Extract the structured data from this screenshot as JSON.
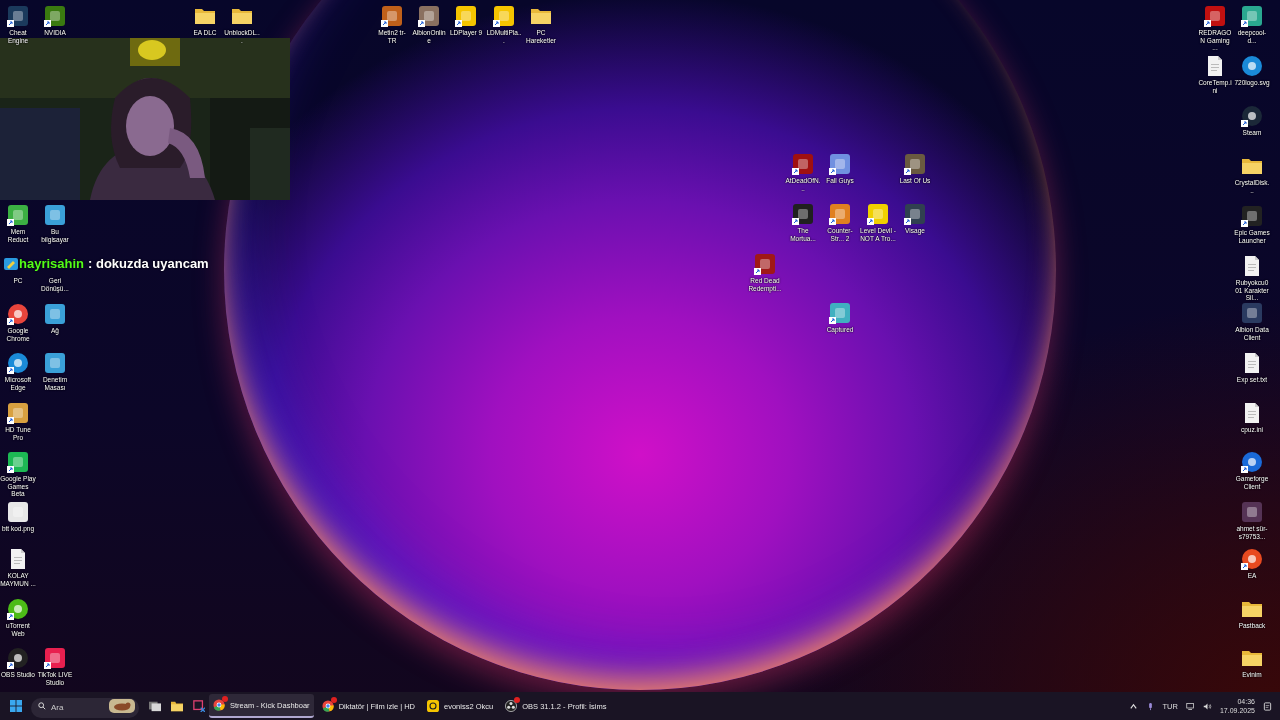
{
  "desktop": {
    "left_icons": [
      {
        "label": "Cheat Engine",
        "shortcut": true
      },
      {
        "label": "NVIDIA",
        "shortcut": true
      },
      {
        "label": "Mem Reduct",
        "shortcut": true
      },
      {
        "label": "Bu bilgisayar",
        "shortcut": false
      },
      {
        "label": "PC",
        "shortcut": false
      },
      {
        "label": "Geri Dönüşü...",
        "shortcut": false
      },
      {
        "label": "Google Chrome",
        "shortcut": true
      },
      {
        "label": "Ağ",
        "shortcut": false
      },
      {
        "label": "Microsoft Edge",
        "shortcut": true
      },
      {
        "label": "Denetim Masası",
        "shortcut": false
      },
      {
        "label": "HD Tune Pro",
        "shortcut": true
      },
      {
        "label": "Google Play Games Beta",
        "shortcut": true
      },
      {
        "label": "btt kod.png",
        "shortcut": false
      },
      {
        "label": "KOLAY MAYMUN ...",
        "shortcut": false
      },
      {
        "label": "uTorrent Web",
        "shortcut": true
      },
      {
        "label": "OBS Studio",
        "shortcut": true
      },
      {
        "label": "TikTok LIVE Studio",
        "shortcut": true
      }
    ],
    "top_icons": [
      {
        "label": "EA DLC",
        "shortcut": false
      },
      {
        "label": "UnblockDL...",
        "shortcut": false
      },
      {
        "label": "Metin2 tr-TR",
        "shortcut": true
      },
      {
        "label": "AlbionOnline",
        "shortcut": true
      },
      {
        "label": "LDPlayer 9",
        "shortcut": true
      },
      {
        "label": "LDMultiPla...",
        "shortcut": true
      },
      {
        "label": "PC Hareketler",
        "shortcut": false
      }
    ],
    "center_icons": [
      {
        "label": "AtDeadOfN...",
        "shortcut": true
      },
      {
        "label": "Fall Guys",
        "shortcut": true
      },
      {
        "label": "Last Of Us",
        "shortcut": true
      },
      {
        "label": "The Mortua...",
        "shortcut": true
      },
      {
        "label": "Counter-Str... 2",
        "shortcut": true
      },
      {
        "label": "Level Devil - NOT A Tro...",
        "shortcut": true
      },
      {
        "label": "Visage",
        "shortcut": true
      },
      {
        "label": "Red Dead Redempti...",
        "shortcut": true
      },
      {
        "label": "Captured",
        "shortcut": true
      }
    ],
    "right_icons": [
      {
        "label": "REDRAGON Gaming ...",
        "shortcut": true
      },
      {
        "label": "deepcool-d...",
        "shortcut": true
      },
      {
        "label": "CoreTemp.ini",
        "shortcut": false
      },
      {
        "label": "720logo.svg",
        "shortcut": false
      },
      {
        "label": "Steam",
        "shortcut": true
      },
      {
        "label": "CrystalDisk...",
        "shortcut": false
      },
      {
        "label": "Epic Games Launcher",
        "shortcut": true
      },
      {
        "label": "Rubyokcu001 Karakter Sil...",
        "shortcut": false
      },
      {
        "label": "Albion Data Client",
        "shortcut": false
      },
      {
        "label": "Exp set.txt",
        "shortcut": false
      },
      {
        "label": "cpuz.ini",
        "shortcut": false
      },
      {
        "label": "Gameforge Client",
        "shortcut": true
      },
      {
        "label": "ahmet sür-s79753...",
        "shortcut": false
      },
      {
        "label": "EA",
        "shortcut": true
      },
      {
        "label": "Pastback",
        "shortcut": false
      },
      {
        "label": "Evinim",
        "shortcut": false
      }
    ]
  },
  "chat_overlay": {
    "username": "hayrisahin",
    "message": ": dokuzda uyancam"
  },
  "taskbar": {
    "search": {
      "placeholder": "Ara"
    },
    "apps": [
      {
        "label": "Stream - Kick Dashboar",
        "selected": true,
        "notification": true
      },
      {
        "label": "Diktatör | Film izle | HD",
        "selected": false,
        "notification": true
      },
      {
        "label": "evoniss2 Okcu",
        "selected": false,
        "notification": false
      },
      {
        "label": "OBS 31.1.2 - Profil: İsims",
        "selected": false,
        "notification": true
      }
    ],
    "tray": {
      "language": "TUR",
      "time": "04:36",
      "date": "17.09.2025"
    }
  }
}
